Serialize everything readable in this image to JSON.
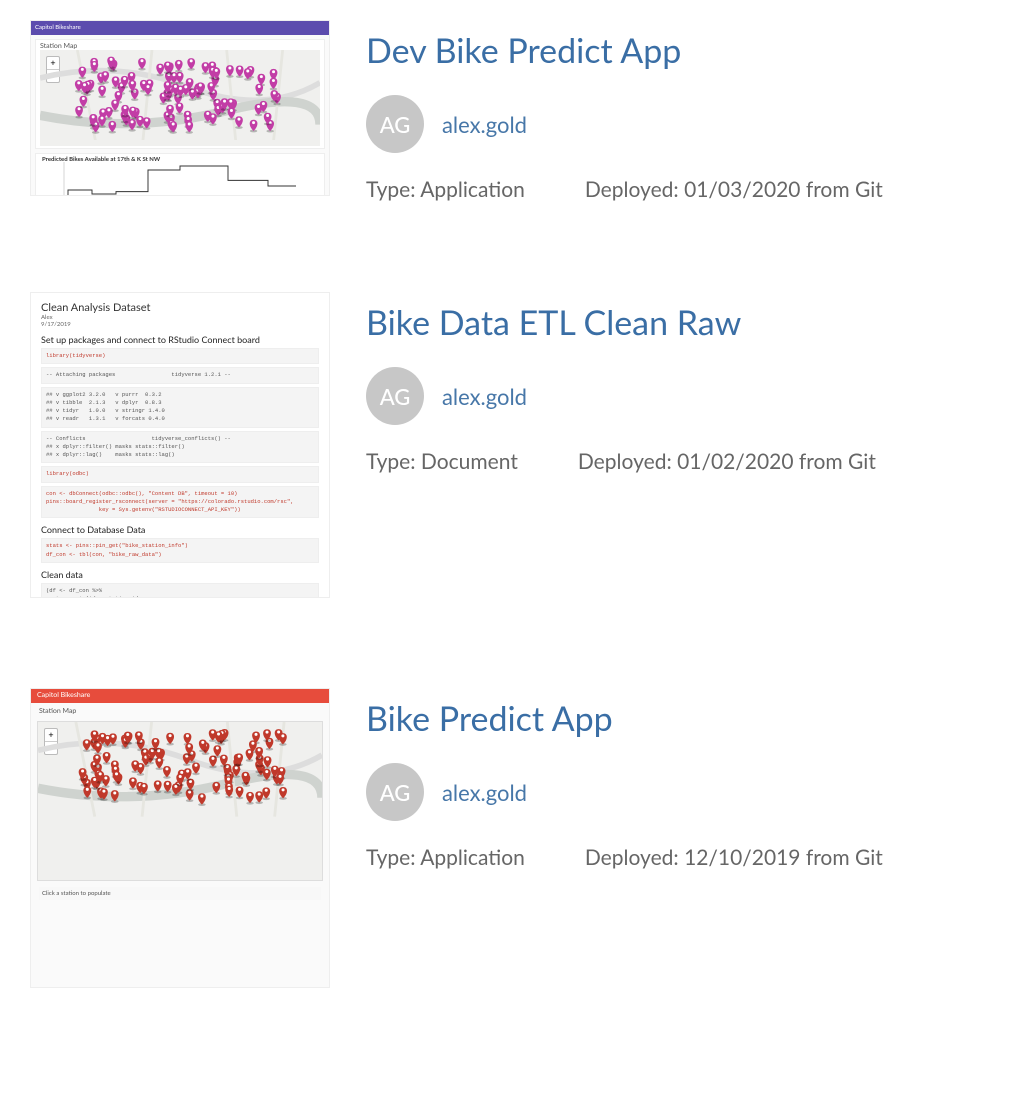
{
  "items": [
    {
      "title": "Dev Bike Predict App",
      "author_initials": "AG",
      "author_name": "alex.gold",
      "type_label": "Type:",
      "type_value": "Application",
      "deployed_label": "Deployed:",
      "deployed_value": "01/03/2020 from Git",
      "thumb": {
        "kind": "app_map_chart",
        "bar_color": "purple",
        "bar_text": "Capitol Bikeshare",
        "panel_label": "Station Map",
        "marker_color": "#c23da6",
        "chart_label": "Predicted Bikes Available at 17th & K St NW"
      }
    },
    {
      "title": "Bike Data ETL Clean Raw",
      "author_initials": "AG",
      "author_name": "alex.gold",
      "type_label": "Type:",
      "type_value": "Document",
      "deployed_label": "Deployed:",
      "deployed_value": "01/02/2020 from Git",
      "thumb": {
        "kind": "document",
        "heading": "Clean Analysis Dataset",
        "byline": "Alex",
        "date": "9/17/2019",
        "section1": "Set up packages and connect to RStudio Connect board",
        "code1": "library(tidyverse)",
        "code2": "-- Attaching packages                 tidyverse 1.2.1 --",
        "code3": "## v ggplot2 3.2.0   v purrr  0.3.2\n## v tibble  2.1.3   v dplyr  0.8.3\n## v tidyr   1.0.0   v stringr 1.4.0\n## v readr   1.3.1   v forcats 0.4.0",
        "code4": "-- Conflicts                    tidyverse_conflicts() --\n## x dplyr::filter() masks stats::filter()\n## x dplyr::lag()    masks stats::lag()",
        "code5": "library(odbc)",
        "code6": "con <- dbConnect(odbc::odbc(), \"Content DB\", timeout = 10)\npins::board_register_rsconnect(server = \"https://colorado.rstudio.com/rsc\",\n                key = Sys.getenv(\"RSTUDIOCONNECT_API_KEY\"))",
        "section2": "Connect to Database Data",
        "code7": "stats <- pins::pin_get(\"bike_station_info\")\ndf_con <- tbl(con, \"bike_raw_data\")",
        "section3": "Clean data",
        "code8": "(df <- df_con %>%\n   transmute(id = station_id,\n             hour = hour(time),\n             date = date(time),\n             month = month(time),\n             n_bikes = num_bikes_available) %>%\n   collect()) %>%"
      }
    },
    {
      "title": "Bike Predict App",
      "author_initials": "AG",
      "author_name": "alex.gold",
      "type_label": "Type:",
      "type_value": "Application",
      "deployed_label": "Deployed:",
      "deployed_value": "12/10/2019 from Git",
      "thumb": {
        "kind": "app_map_only",
        "bar_color": "red",
        "bar_text": "Capitol Bikeshare",
        "panel_label": "Station Map",
        "marker_color": "#c0392b",
        "below_text": "Click a station to populate"
      }
    }
  ]
}
